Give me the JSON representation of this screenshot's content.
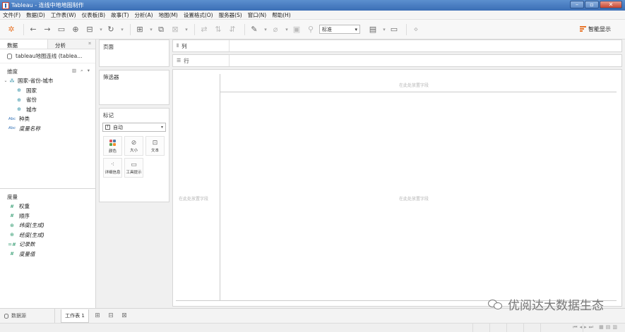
{
  "window": {
    "title": "Tableau - 连线中地地图制作"
  },
  "menu": [
    "文件(F)",
    "数据(D)",
    "工作表(W)",
    "仪表板(B)",
    "故事(T)",
    "分析(A)",
    "地图(M)",
    "设置格式(O)",
    "服务器(S)",
    "窗口(N)",
    "帮助(H)"
  ],
  "toolbar": {
    "view_select": "标准",
    "smart_show": "智能显示"
  },
  "sidebar": {
    "tab_data": "数据",
    "tab_analysis": "分析",
    "datasource": "tableau地图连线 (tablea...",
    "dimensions_title": "维度",
    "hierarchy": "国家-省份-城市",
    "hierarchy_children": [
      "国家",
      "省份",
      "城市"
    ],
    "dim_fields": [
      "种类",
      "度量名称"
    ],
    "measures_title": "度量",
    "measure_fields": [
      "权重",
      "顺序",
      "纬度(生成)",
      "经度(生成)",
      "记录数",
      "度量值"
    ]
  },
  "cards": {
    "pages": "页面",
    "filters": "筛选器",
    "marks": "标记",
    "mark_type": "自动",
    "mark_buttons": [
      "颜色",
      "大小",
      "文本",
      "详细信息",
      "工具提示"
    ]
  },
  "shelves": {
    "columns": "列",
    "rows": "行"
  },
  "canvas": {
    "drop_top": "在此处放置字段",
    "drop_left": "在此处放置字段",
    "drop_center": "在此处放置字段"
  },
  "bottom": {
    "datasource_tab": "数据源",
    "sheet_tab": "工作表 1"
  },
  "watermark": "优阅达大数据生态"
}
